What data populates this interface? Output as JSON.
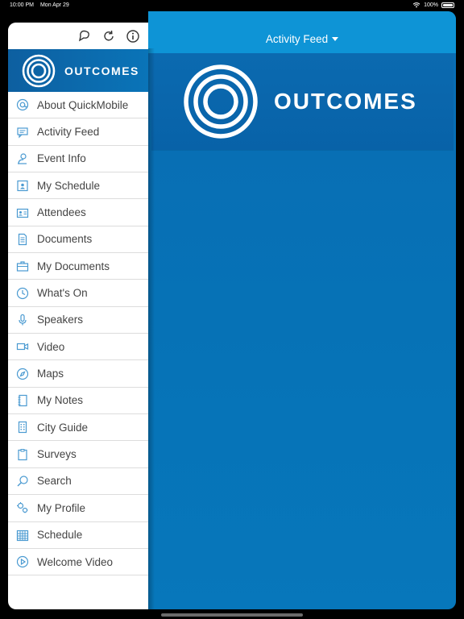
{
  "status_bar": {
    "time": "10:00 PM",
    "date": "Mon Apr 29",
    "battery": "100%"
  },
  "sidebar": {
    "brand_text": "OUTCOMES",
    "toolbar_icons": [
      "bookmark-icon",
      "refresh-icon",
      "info-icon"
    ],
    "items": [
      {
        "label": "About QuickMobile",
        "icon": "at-icon"
      },
      {
        "label": "Activity Feed",
        "icon": "feed-icon"
      },
      {
        "label": "Event Info",
        "icon": "event-icon"
      },
      {
        "label": "My Schedule",
        "icon": "calendar-person-icon"
      },
      {
        "label": "Attendees",
        "icon": "id-card-icon"
      },
      {
        "label": "Documents",
        "icon": "document-icon"
      },
      {
        "label": "My Documents",
        "icon": "briefcase-icon"
      },
      {
        "label": "What's On",
        "icon": "clock-icon"
      },
      {
        "label": "Speakers",
        "icon": "microphone-icon"
      },
      {
        "label": "Video",
        "icon": "video-camera-icon"
      },
      {
        "label": "Maps",
        "icon": "compass-icon"
      },
      {
        "label": "My Notes",
        "icon": "notebook-icon"
      },
      {
        "label": "City Guide",
        "icon": "building-icon"
      },
      {
        "label": "Surveys",
        "icon": "clipboard-icon"
      },
      {
        "label": "Search",
        "icon": "search-icon"
      },
      {
        "label": "My Profile",
        "icon": "gears-icon"
      },
      {
        "label": "Schedule",
        "icon": "grid-calendar-icon"
      },
      {
        "label": "Welcome Video",
        "icon": "play-circle-icon"
      }
    ]
  },
  "main": {
    "title": "Activity Feed",
    "banner_text": "OUTCOMES"
  },
  "colors": {
    "brand_blue": "#0a6cb3",
    "header_blue": "#0e94d6",
    "icon_blue": "#4a9ad1"
  }
}
